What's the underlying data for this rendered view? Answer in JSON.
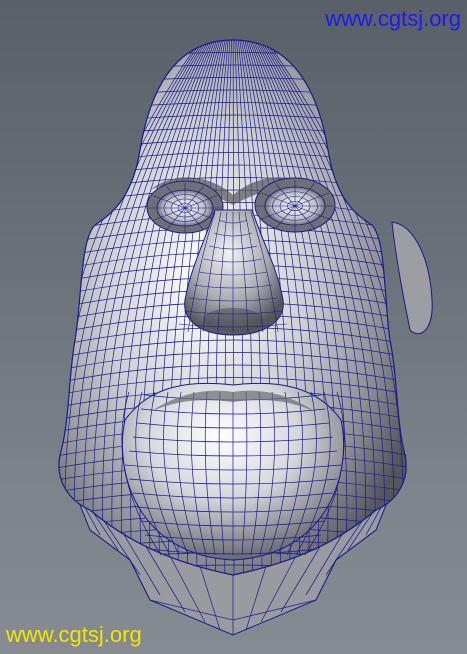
{
  "watermarks": {
    "top": "www.cgtsj.org",
    "bottom": "www.cgtsj.org"
  },
  "colors": {
    "wire": "#1a1a8c",
    "watermark_top": "#1a1cf0",
    "watermark_bottom": "#f2e600",
    "skin_light": "#f2f2f2",
    "skin_dark": "#5c5c62"
  },
  "model": {
    "icon": "wireframe-head-mesh"
  }
}
